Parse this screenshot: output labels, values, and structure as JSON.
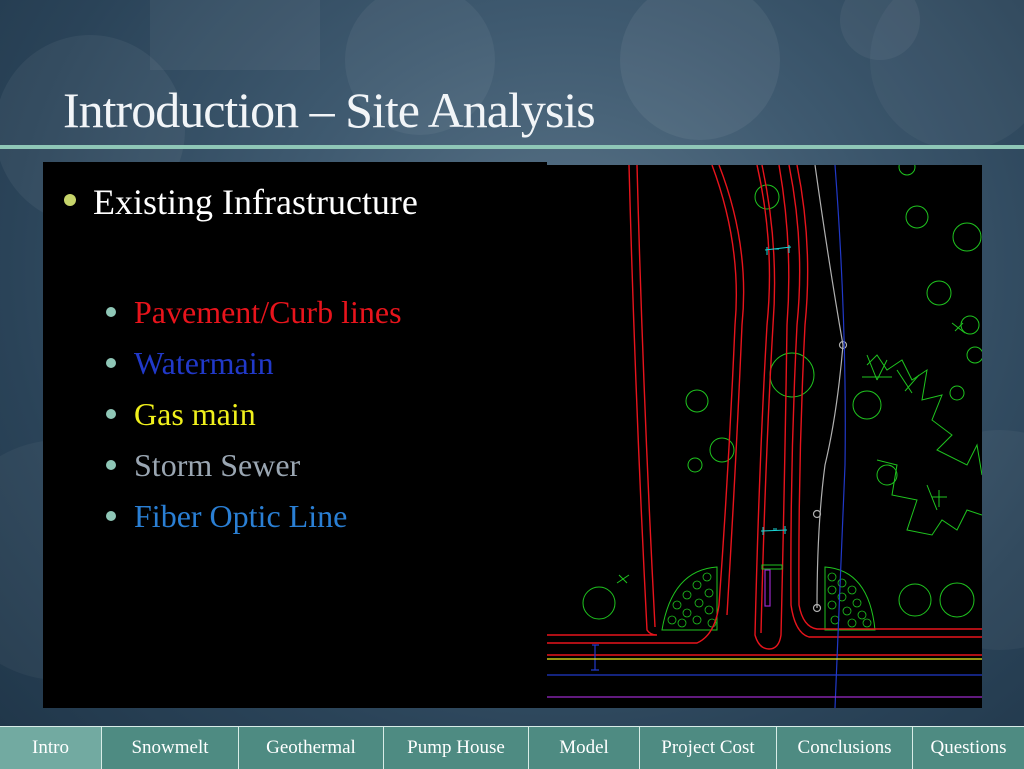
{
  "slide": {
    "title": "Introduction – Site Analysis"
  },
  "content": {
    "main_bullet": "Existing Infrastructure",
    "sub_items": [
      {
        "label": "Pavement/Curb lines",
        "color": "#e8141c"
      },
      {
        "label": "Watermain",
        "color": "#2139c9"
      },
      {
        "label": "Gas main",
        "color": "#f0f01c"
      },
      {
        "label": "Storm Sewer",
        "color": "#9aa6b2"
      },
      {
        "label": "Fiber Optic Line",
        "color": "#2a7fd4"
      }
    ]
  },
  "nav": {
    "items": [
      "Intro",
      "Snowmelt",
      "Geothermal",
      "Pump House",
      "Model",
      "Project Cost",
      "Conclusions",
      "Questions"
    ],
    "active": "Intro"
  },
  "colors": {
    "accent_rule": "#8fc7b7",
    "nav_bg": "#4e8b82",
    "nav_active_bg": "#72aaa1",
    "cad_curb": "#e8141c",
    "cad_vegetation": "#1fc41f",
    "cad_watermain": "#2139c9",
    "cad_gas": "#f0f01c",
    "cad_storm": "#b0b0b0",
    "cad_fiber": "#2a7fd4"
  }
}
